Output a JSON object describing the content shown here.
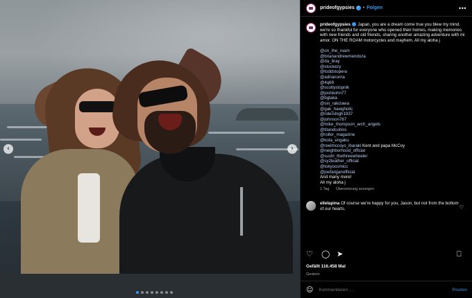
{
  "post": {
    "username": "prideofgypsies",
    "separator": "•",
    "follow_label": "Folgen",
    "more_label": "•••"
  },
  "caption": {
    "username": "prideofgypsies",
    "text": "Japan, you are a dream come true you blew my mind. we're so thankful for everyone who opened their homes, making memories with new friends and old friends, sharing another amazing adventure with mi amor. ON THE ROAM motorcycles and mayhem. All my aloha j",
    "tags": [
      "@on_the_roam",
      "@brianandrewmendoza",
      "@da_bray",
      "@stockezy",
      "@toddstopera",
      "@adrianorna",
      "@4q69",
      "@scottystopnik",
      "@joshkohn77",
      "@bgtaka",
      "@sin_rakizawa",
      "@gak_hawgholic",
      "@ridershigh1937",
      "@johnson767",
      "@mike_thompson_arch_angels",
      "@titandcohiro",
      "@roller_magazine",
      "@kota_engaku"
    ],
    "tag_with_text": {
      "tag": "@reelmccoys_ibaraki",
      "text": " Kent and papa McCoy"
    },
    "tags2": [
      "@neighborhood_official",
      "@sushi_thethreewheeler",
      "@sy2leather_official",
      "@tokyocomicc",
      "@joefanjjanofficial"
    ],
    "closing": [
      "And many more!",
      "All my aloha j"
    ],
    "time": "1 Tag",
    "translate_label": "Übersetzung anzeigen"
  },
  "comment": {
    "username": "ellelapina",
    "text": "Of course we're happy for you, Jason, but not from the bottom of our hearts."
  },
  "actions": {
    "like_icon": "heart-icon",
    "comment_icon": "comment-icon",
    "share_icon": "share-icon",
    "save_icon": "bookmark-icon"
  },
  "likes_label": "Gefällt 116.458 Mal",
  "date_label": "Gestern",
  "add_comment": {
    "placeholder": "Kommentieren ...",
    "post_label": "Posten"
  },
  "carousel": {
    "prev_glyph": "‹",
    "next_glyph": "›",
    "slide_count": 8,
    "active_slide": 1
  },
  "colors": {
    "accent": "#3897f0",
    "link": "#b6cdf2",
    "background": "#000000"
  }
}
